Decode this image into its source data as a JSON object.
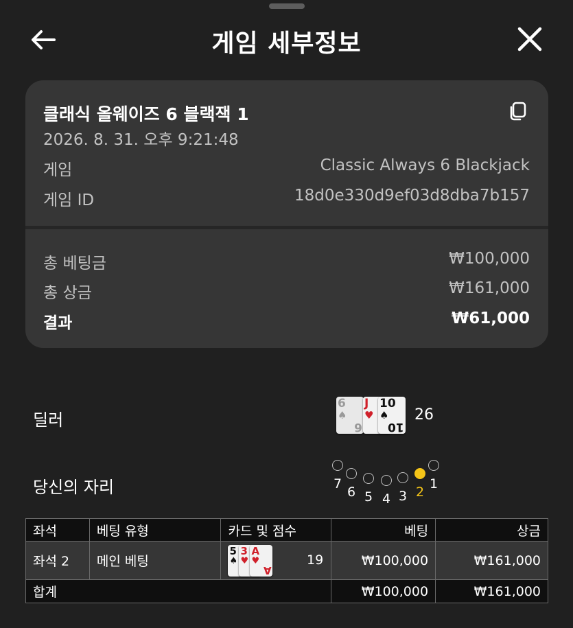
{
  "header": {
    "title": "게임 세부정보",
    "back_icon": "arrow-left-icon",
    "close_icon": "close-icon"
  },
  "summary": {
    "game_name": "클래식 올웨이즈 6 블랙잭 1",
    "datetime": "2026. 8. 31. 오후 9:21:48",
    "copy_icon": "copy-icon",
    "rows": [
      {
        "label": "게임",
        "value": "Classic Always 6 Blackjack"
      },
      {
        "label": "게임 ID",
        "value": "18d0e330d9ef03d8dba7b157"
      }
    ],
    "totals": [
      {
        "label": "총 베팅금",
        "value": "₩100,000"
      },
      {
        "label": "총 상금",
        "value": "₩161,000"
      },
      {
        "label": "결과",
        "value": "₩61,000"
      }
    ]
  },
  "dealer": {
    "label": "딜러",
    "score": "26",
    "cards": [
      {
        "rank": "6",
        "suit": "♠",
        "color": "#9a9a9a",
        "faded": true
      },
      {
        "rank": "J",
        "suit": "♥",
        "color": "#d0202a",
        "faded": false
      },
      {
        "rank": "10",
        "suit": "♠",
        "color": "#111111",
        "faded": false
      }
    ]
  },
  "seat": {
    "label": "당신의 자리",
    "numbers": [
      "7",
      "6",
      "5",
      "4",
      "3",
      "2",
      "1"
    ],
    "active": "2"
  },
  "table": {
    "headers": [
      "좌석",
      "베팅 유형",
      "카드 및 점수",
      "베팅",
      "상금"
    ],
    "rows": [
      {
        "seat": "좌석 2",
        "bet_type": "메인 베팅",
        "score": "19",
        "bet": "₩100,000",
        "win": "₩161,000",
        "cards": [
          {
            "rank": "5",
            "suit": "♠",
            "color": "#111111"
          },
          {
            "rank": "3",
            "suit": "♥",
            "color": "#d0202a"
          },
          {
            "rank": "A",
            "suit": "♥",
            "color": "#d0202a"
          }
        ]
      }
    ],
    "total": {
      "label": "합계",
      "bet": "₩100,000",
      "win": "₩161,000"
    }
  }
}
